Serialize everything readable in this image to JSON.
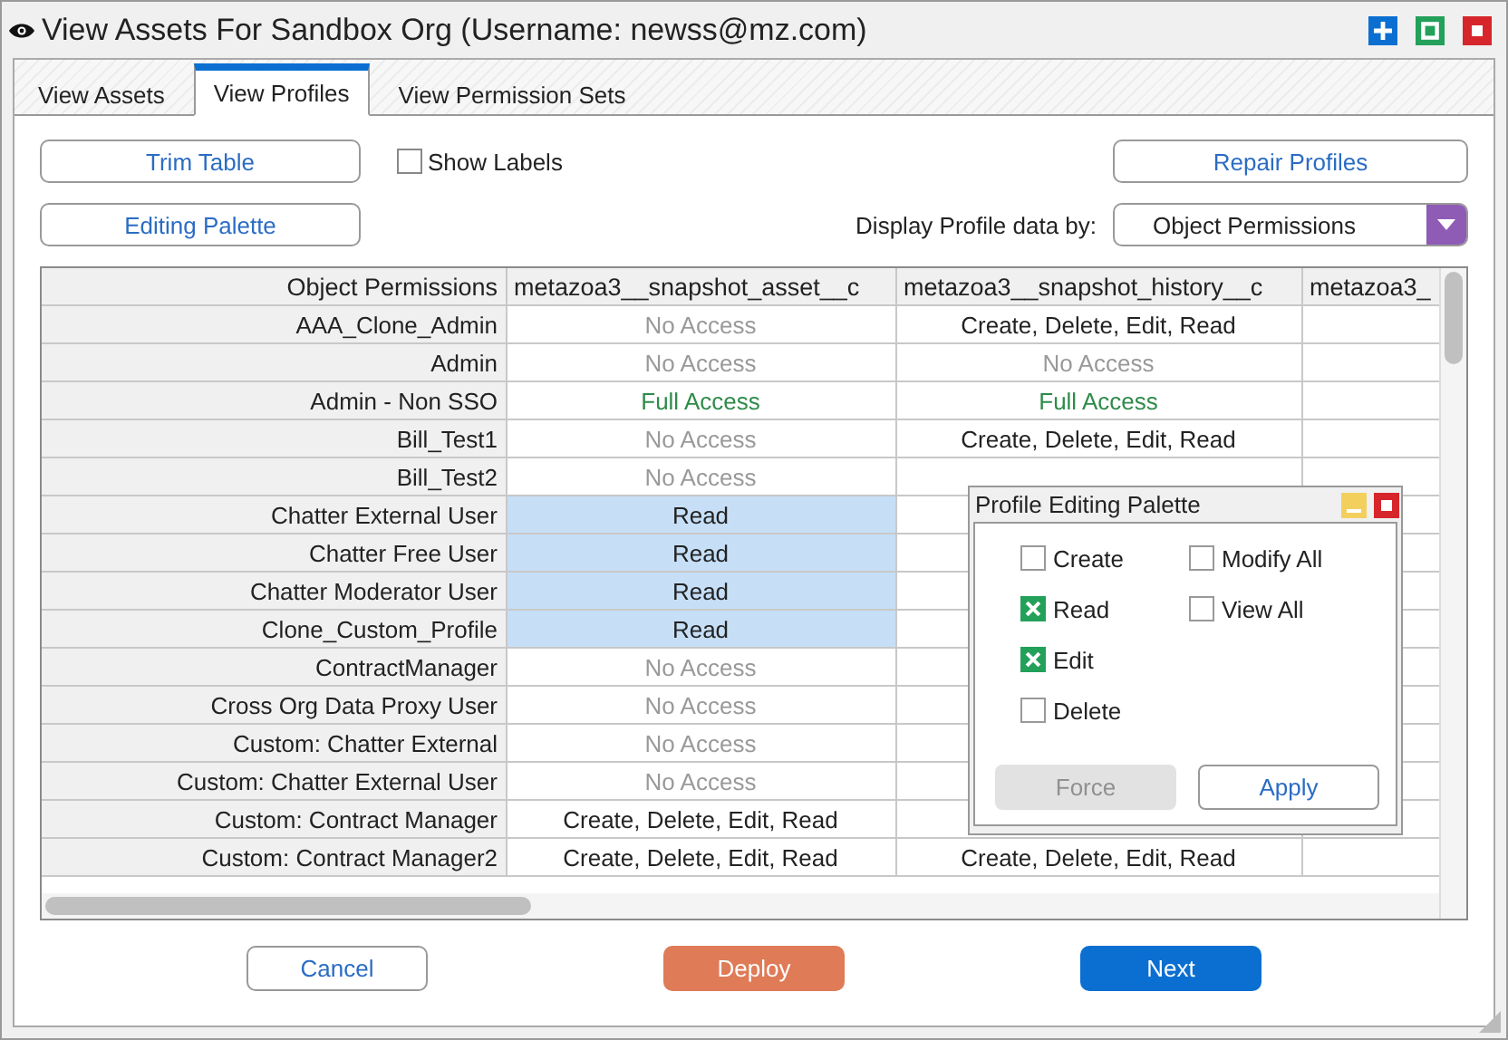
{
  "window": {
    "title": "View Assets For Sandbox Org (Username: newss@mz.com)"
  },
  "tabs": [
    {
      "label": "View Assets",
      "selected": false
    },
    {
      "label": "View Profiles",
      "selected": true
    },
    {
      "label": "View Permission Sets",
      "selected": false
    }
  ],
  "toolbar": {
    "trim_button": "Trim Table",
    "show_labels": {
      "label": "Show Labels",
      "checked": false
    },
    "repair_button": "Repair Profiles",
    "palette_button": "Editing Palette",
    "display_label": "Display Profile data by:",
    "display_select": "Object Permissions"
  },
  "table": {
    "row_header_title": "Object Permissions",
    "columns": [
      "metazoa3__snapshot_asset__c",
      "metazoa3__snapshot_history__c",
      "metazoa3_"
    ],
    "rows": [
      {
        "profile": "AAA_Clone_Admin",
        "cells": [
          {
            "text": "No Access",
            "kind": "none",
            "selected": false
          },
          {
            "text": "Create, Delete, Edit, Read",
            "kind": "plain",
            "selected": false
          }
        ]
      },
      {
        "profile": "Admin",
        "cells": [
          {
            "text": "No Access",
            "kind": "none",
            "selected": false
          },
          {
            "text": "No Access",
            "kind": "none",
            "selected": false
          }
        ]
      },
      {
        "profile": "Admin - Non SSO",
        "cells": [
          {
            "text": "Full Access",
            "kind": "full",
            "selected": false
          },
          {
            "text": "Full Access",
            "kind": "full",
            "selected": false
          }
        ]
      },
      {
        "profile": "Bill_Test1",
        "cells": [
          {
            "text": "No Access",
            "kind": "none",
            "selected": false
          },
          {
            "text": "Create, Delete, Edit, Read",
            "kind": "plain",
            "selected": false
          }
        ]
      },
      {
        "profile": "Bill_Test2",
        "cells": [
          {
            "text": "No Access",
            "kind": "none",
            "selected": false
          },
          null
        ]
      },
      {
        "profile": "Chatter External User",
        "cells": [
          {
            "text": "Read",
            "kind": "plain",
            "selected": true
          },
          null
        ]
      },
      {
        "profile": "Chatter Free User",
        "cells": [
          {
            "text": "Read",
            "kind": "plain",
            "selected": true
          },
          null
        ]
      },
      {
        "profile": "Chatter Moderator User",
        "cells": [
          {
            "text": "Read",
            "kind": "plain",
            "selected": true
          },
          null
        ]
      },
      {
        "profile": "Clone_Custom_Profile",
        "cells": [
          {
            "text": "Read",
            "kind": "plain",
            "selected": true
          },
          null
        ]
      },
      {
        "profile": "ContractManager",
        "cells": [
          {
            "text": "No Access",
            "kind": "none",
            "selected": false
          },
          null
        ]
      },
      {
        "profile": "Cross Org Data Proxy User",
        "cells": [
          {
            "text": "No Access",
            "kind": "none",
            "selected": false
          },
          null
        ]
      },
      {
        "profile": "Custom: Chatter External",
        "cells": [
          {
            "text": "No Access",
            "kind": "none",
            "selected": false
          },
          null
        ]
      },
      {
        "profile": "Custom: Chatter External User",
        "cells": [
          {
            "text": "No Access",
            "kind": "none",
            "selected": false
          },
          null
        ]
      },
      {
        "profile": "Custom: Contract Manager",
        "cells": [
          {
            "text": "Create, Delete, Edit, Read",
            "kind": "plain",
            "selected": false
          },
          null
        ]
      },
      {
        "profile": "Custom: Contract Manager2",
        "cells": [
          {
            "text": "Create, Delete, Edit, Read",
            "kind": "plain",
            "selected": false
          },
          {
            "text": "Create, Delete, Edit, Read",
            "kind": "plain",
            "selected": false
          }
        ]
      }
    ]
  },
  "palette": {
    "title": "Profile Editing Palette",
    "options": [
      {
        "label": "Create",
        "checked": false
      },
      {
        "label": "Read",
        "checked": true
      },
      {
        "label": "Edit",
        "checked": true
      },
      {
        "label": "Delete",
        "checked": false
      },
      {
        "label": "Modify All",
        "checked": false
      },
      {
        "label": "View All",
        "checked": false
      }
    ],
    "force_button": {
      "label": "Force",
      "disabled": true
    },
    "apply_button": "Apply"
  },
  "footer": {
    "cancel": "Cancel",
    "deploy": "Deploy",
    "next": "Next"
  }
}
